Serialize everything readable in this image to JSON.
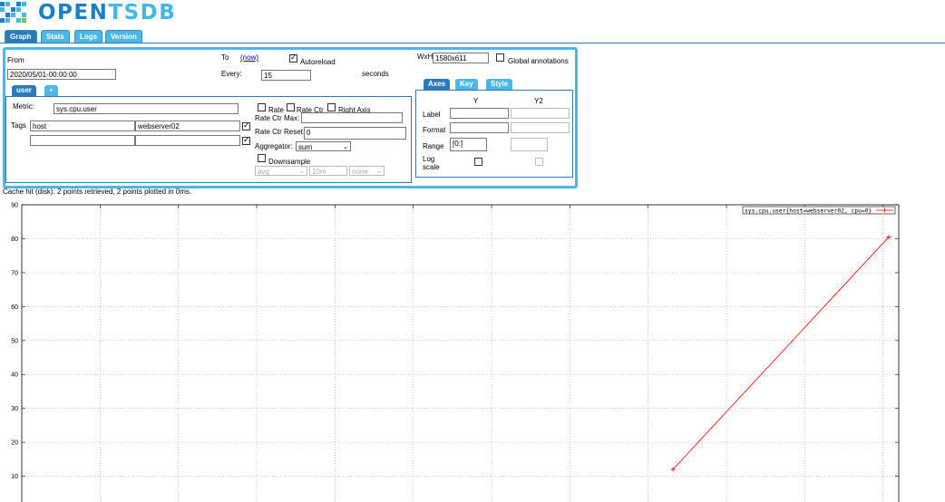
{
  "logo": {
    "text_a": "OPEN",
    "text_b": "TSDB"
  },
  "tabs": [
    {
      "label": "Graph",
      "active": true
    },
    {
      "label": "Stats",
      "active": false
    },
    {
      "label": "Logs",
      "active": false
    },
    {
      "label": "Version",
      "active": false
    }
  ],
  "query": {
    "from_label": "From",
    "from_value": "2020/05/01-00:00:00",
    "to_label": "To",
    "to_link": "(now)",
    "autoreload_label": "Autoreload",
    "autoreload_checked": true,
    "every_label": "Every:",
    "every_value": "15",
    "seconds_label": "seconds",
    "wxh_label": "WxH:",
    "wxh_value": "1580x611",
    "global_annotations_label": "Global annotations",
    "metric_tabs": [
      "user",
      "+"
    ],
    "metric_label": "Metric:",
    "metric_value": "sys.cpu.user",
    "tags_label": "Tags",
    "tag_rows": [
      {
        "key": "host",
        "value": "webserver02",
        "checked": true
      },
      {
        "key": "",
        "value": "",
        "checked": true
      }
    ],
    "rate_label": "Rate",
    "rate_ctr_label": "Rate Ctr",
    "right_axis_label": "Right Axis",
    "rate_ctr_max_label": "Rate Ctr Max:",
    "rate_ctr_reset_label": "Rate Ctr Reset:",
    "rate_ctr_reset_value": "0",
    "aggregator_label": "Aggregator:",
    "aggregator_value": "sum",
    "downsample_label": "Downsample",
    "downsample_func": "avg",
    "downsample_interval": "10m",
    "downsample_fill": "none"
  },
  "axes": {
    "tabs": [
      "Axes",
      "Key",
      "Style"
    ],
    "y_header": "Y",
    "y2_header": "Y2",
    "label_label": "Label",
    "format_label": "Format",
    "range_label": "Range",
    "range_y_value": "[0:]",
    "log_label": "Log",
    "log_label2": "scale"
  },
  "status_text": "Cache hit (disk). 2 points retrieved, 2 points plotted in 0ms.",
  "chart_data": {
    "type": "line",
    "ylim": [
      0,
      90
    ],
    "yticks": [
      10,
      20,
      30,
      40,
      50,
      60,
      70,
      80,
      90
    ],
    "series": [
      {
        "name": "sys.cpu.user{host=webserver02, cpu=0}",
        "color": "#ff0000",
        "points": [
          [
            0,
            12
          ],
          [
            1,
            80.5
          ]
        ]
      }
    ],
    "grid": true,
    "legend_position": "top-right"
  }
}
